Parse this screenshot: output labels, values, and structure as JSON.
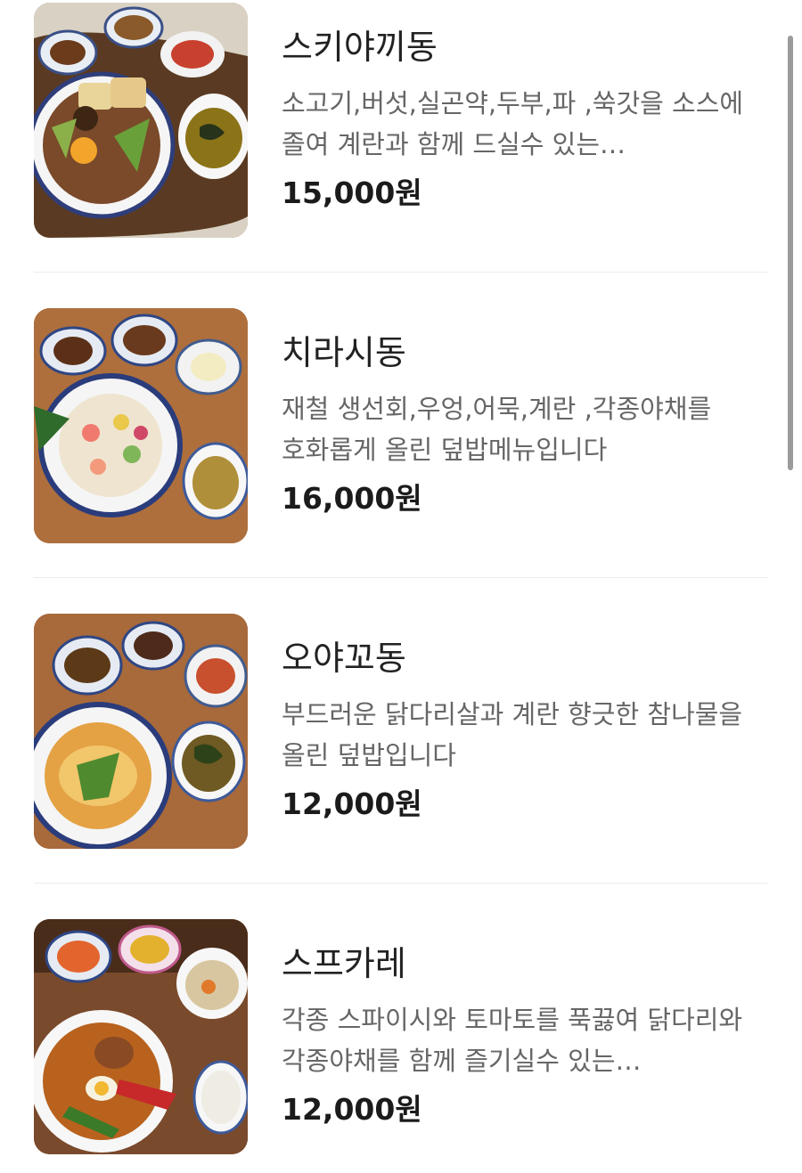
{
  "menu": {
    "items": [
      {
        "name": "스키야끼동",
        "description": "소고기,버섯,실곤약,두부,파 ,쑥갓을 소스에 졸여 계란과 함께 드실수 있는 덮밥메뉴입니다",
        "price": "15,000원",
        "photo_icon": "sukiyaki-don-photo"
      },
      {
        "name": "치라시동",
        "description": "재철 생선회,우엉,어묵,계란 ,각종야채를 호화롭게 올린 덮밥메뉴입니다",
        "price": "16,000원",
        "photo_icon": "chirashi-don-photo"
      },
      {
        "name": "오야꼬동",
        "description": "부드러운 닭다리살과 계란 향긋한 참나물을 올린 덮밥입니다",
        "price": "12,000원",
        "photo_icon": "oyako-don-photo"
      },
      {
        "name": "스프카레",
        "description": "각종 스파이시와 토마토를 푹끓여 닭다리와 각종야채를 함께 즐기실수 있는 스프카레입니다",
        "price": "12,000원",
        "photo_icon": "soup-curry-photo"
      }
    ]
  },
  "colors": {
    "background": "#ffffff",
    "name_text": "#222222",
    "description_text": "#666666",
    "price_text": "#1b1b1b",
    "divider": "#ececec",
    "scrollbar": "#9b9b9b"
  }
}
